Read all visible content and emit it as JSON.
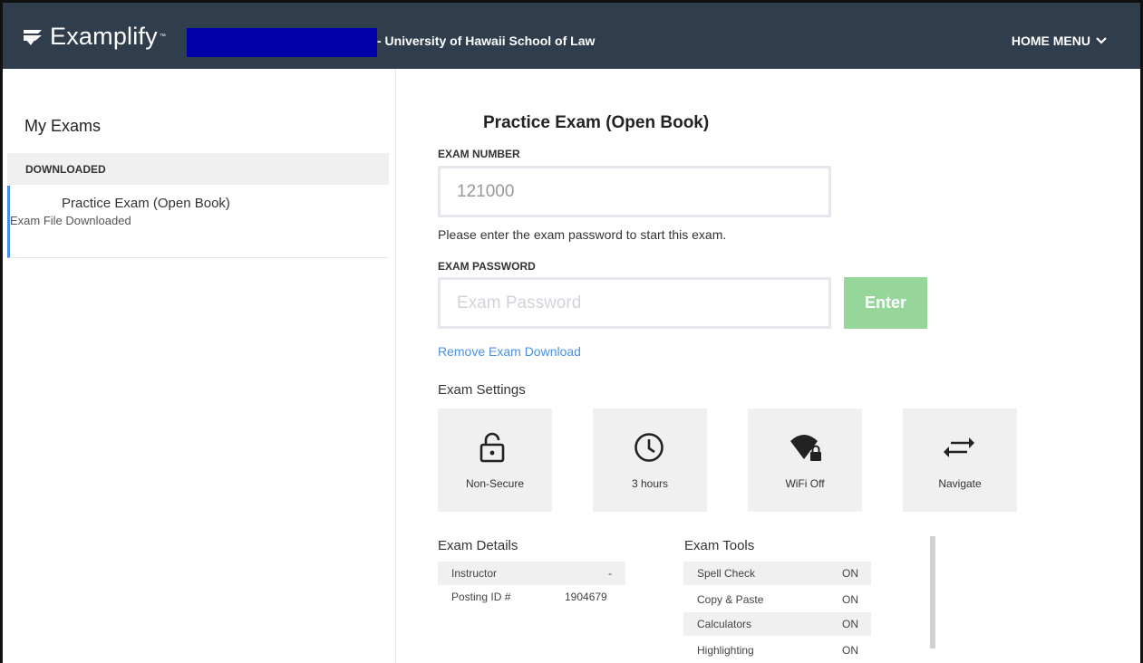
{
  "header": {
    "app_name": "Examplify",
    "tm": "™",
    "school": "- University of Hawaii School of Law",
    "home_menu": "HOME MENU"
  },
  "sidebar": {
    "title": "My Exams",
    "section": "DOWNLOADED",
    "exam": {
      "title": "Practice Exam (Open Book)",
      "status": "Exam File Downloaded"
    }
  },
  "main": {
    "exam_title": "Practice Exam (Open Book)",
    "exam_number_label": "EXAM NUMBER",
    "exam_number_value": "121000",
    "help_text": "Please enter the exam password to start this exam.",
    "exam_password_label": "EXAM PASSWORD",
    "exam_password_placeholder": "Exam Password",
    "enter_button": "Enter",
    "remove_link": "Remove Exam Download",
    "settings_title": "Exam Settings",
    "settings": [
      {
        "label": "Non-Secure",
        "icon": "unlocked-padlock-icon"
      },
      {
        "label": "3 hours",
        "icon": "clock-icon"
      },
      {
        "label": "WiFi Off",
        "icon": "wifi-locked-icon"
      },
      {
        "label": "Navigate",
        "icon": "swap-arrows-icon"
      }
    ],
    "details_title": "Exam Details",
    "details": [
      {
        "key": "Instructor",
        "value": "-"
      },
      {
        "key": "Posting ID #",
        "value": "1904679"
      }
    ],
    "tools_title": "Exam Tools",
    "tools": [
      {
        "key": "Spell Check",
        "value": "ON"
      },
      {
        "key": "Copy & Paste",
        "value": "ON"
      },
      {
        "key": "Calculators",
        "value": "ON"
      },
      {
        "key": "Highlighting",
        "value": "ON"
      }
    ]
  },
  "colors": {
    "topbar": "#2f3d4c",
    "enter_button": "#96d69a",
    "link": "#4a90e2",
    "tile_bg": "#f0f0f0"
  }
}
